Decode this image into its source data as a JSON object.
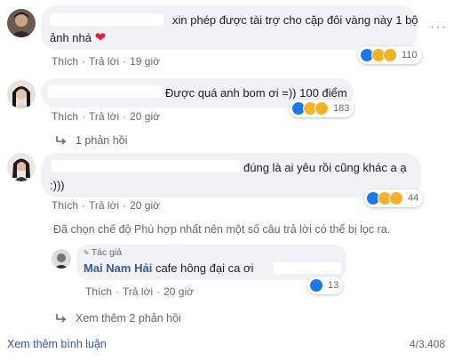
{
  "comments": [
    {
      "text": "xin phép được tài trợ cho cặp đôi vàng này 1 bộ",
      "text_line2": "ảnh nhá",
      "heart": "❤",
      "like_label": "Thích",
      "reply_label": "Trả lời",
      "time": "19 giờ",
      "reaction_count": "110",
      "reaction_icons": [
        "like-icon",
        "haha-icon",
        "care-icon"
      ]
    },
    {
      "text": "Được quá anh bom ơi =)) 100 điểm",
      "like_label": "Thích",
      "reply_label": "Trả lời",
      "time": "20 giờ",
      "reaction_count": "183",
      "reaction_icons": [
        "like-icon",
        "haha-icon",
        "care-icon"
      ],
      "replies_link": "1 phản hồi"
    },
    {
      "text": "đúng là ai yêu rồi cũng khác a ạ",
      "text_line2": ":)))",
      "like_label": "Thích",
      "reply_label": "Trả lời",
      "time": "20 giờ",
      "reaction_count": "44",
      "reaction_icons": [
        "like-icon",
        "haha-icon",
        "care-icon"
      ]
    }
  ],
  "filter_notice": "Đã chọn chế độ Phù hợp nhất nên một số câu trả lời có thể bị lọc ra.",
  "reply": {
    "badge": "Tác giả",
    "author": "Mai Nam Hải",
    "text": "cafe hông đại ca ơi",
    "like_label": "Thích",
    "reply_label": "Trả lời",
    "time": "20 giờ",
    "reaction_count": "13",
    "reaction_icons": [
      "like-icon"
    ]
  },
  "more_replies": "Xem thêm 2 phản hồi",
  "footer": {
    "more_comments": "Xem thêm bình luận",
    "count": "4/3.408"
  },
  "colors": {
    "bubble": "#f0f2f5",
    "meta_text": "#65676b",
    "link": "#385898",
    "like_blue": "#1877f2",
    "heart_red": "#e41e3f"
  }
}
